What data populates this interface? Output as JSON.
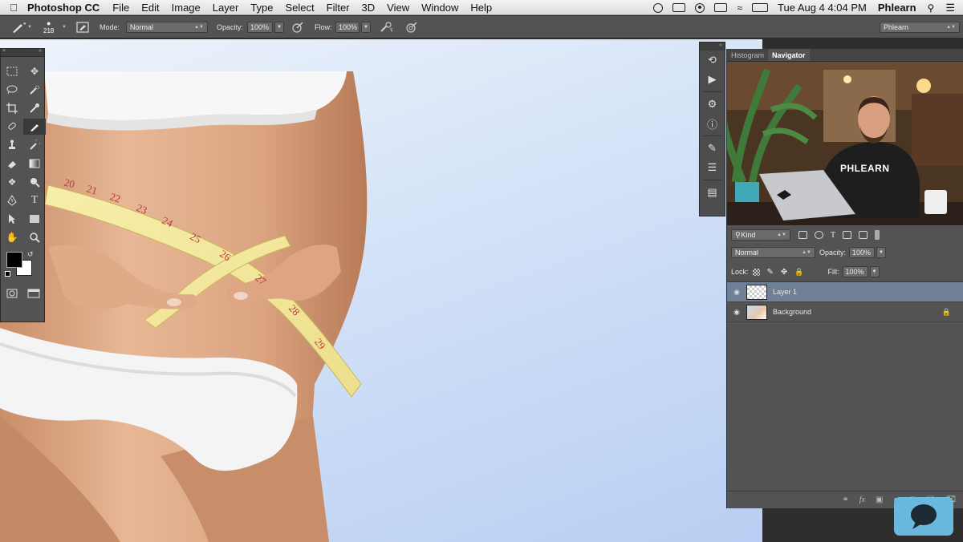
{
  "menubar": {
    "app_name": "Photoshop CC",
    "items": [
      "File",
      "Edit",
      "Image",
      "Layer",
      "Type",
      "Select",
      "Filter",
      "3D",
      "View",
      "Window",
      "Help"
    ],
    "datetime": "Tue Aug 4  4:04 PM",
    "user": "Phlearn"
  },
  "options_bar": {
    "brush_size": "218",
    "mode_label": "Mode:",
    "mode_value": "Normal",
    "opacity_label": "Opacity:",
    "opacity_value": "100%",
    "flow_label": "Flow:",
    "flow_value": "100%",
    "workspace": "Phlearn"
  },
  "toolbar": {
    "foreground_color": "#000000",
    "background_color": "#ffffff"
  },
  "navigator": {
    "tabs": [
      "Histogram",
      "Navigator"
    ],
    "active_tab": "Navigator",
    "shirt_text": "PHLEARN"
  },
  "layers": {
    "filter_label": "Kind",
    "blend_mode": "Normal",
    "opacity_label": "Opacity:",
    "opacity_value": "100%",
    "lock_label": "Lock:",
    "fill_label": "Fill:",
    "fill_value": "100%",
    "items": [
      {
        "name": "Layer 1",
        "selected": true
      },
      {
        "name": "Background",
        "locked": true
      }
    ]
  },
  "tape_numbers": [
    "20",
    "21",
    "22",
    "23",
    "24",
    "25",
    "26",
    "27",
    "28",
    "29"
  ],
  "colors": {
    "panel": "#535353",
    "selected_layer": "#6f7f95",
    "canvas_bg": "#c4d6f4",
    "accent_chat": "#6bb8de"
  }
}
